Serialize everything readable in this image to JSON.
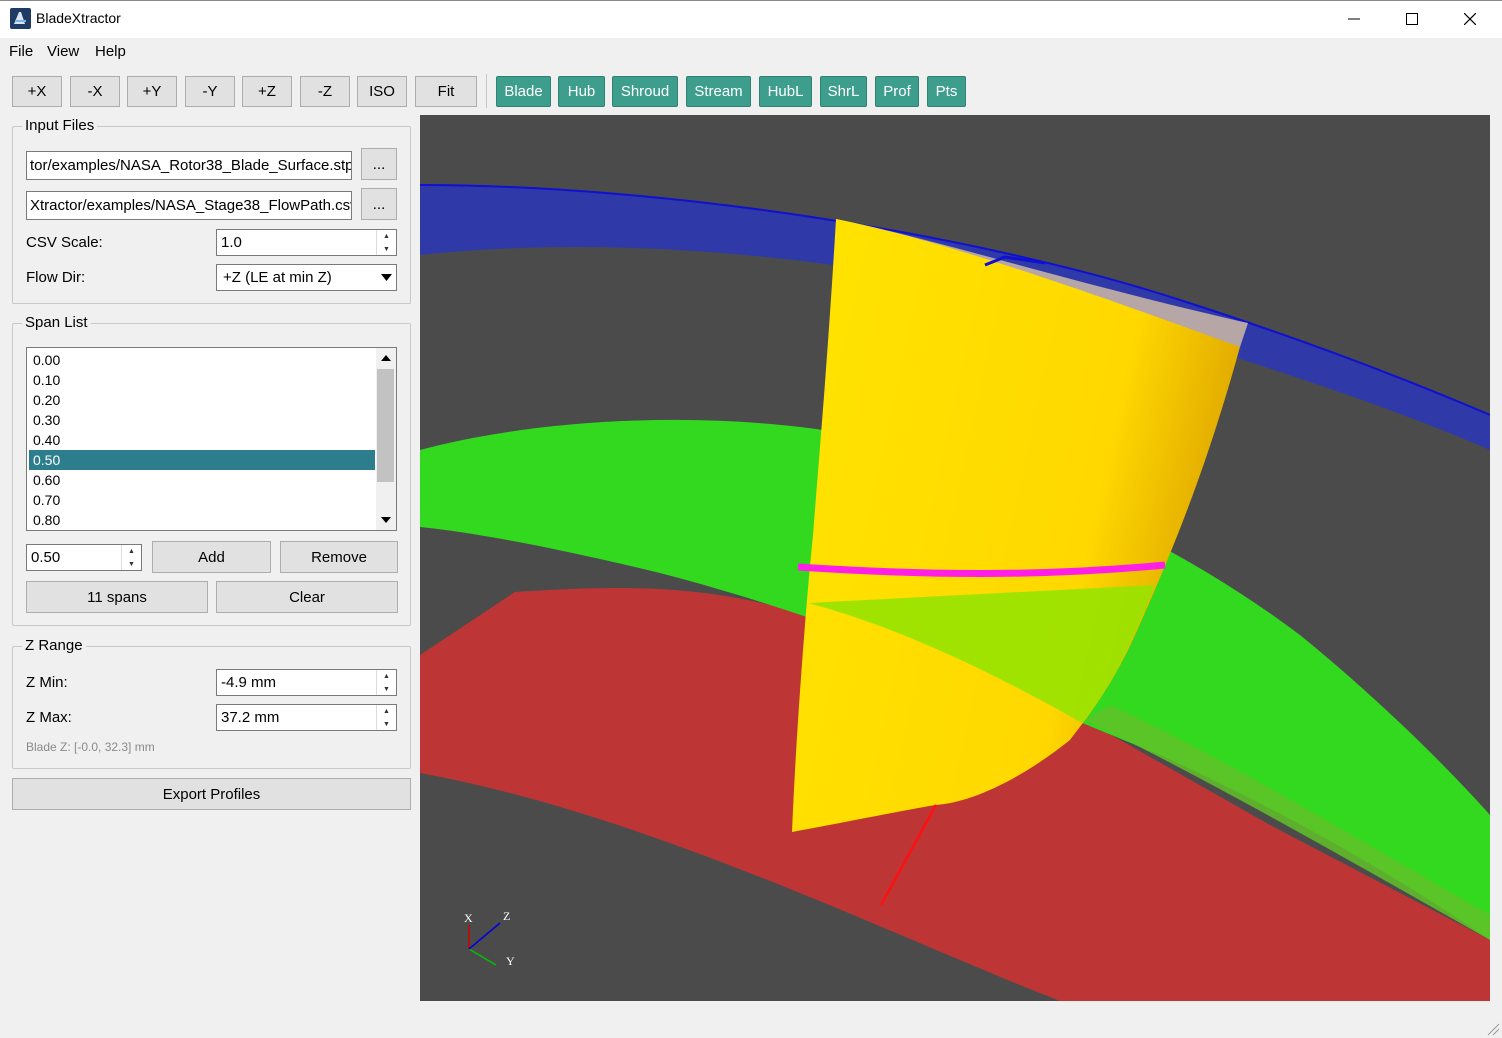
{
  "window": {
    "title": "BladeXtractor",
    "minimize_glyph": "—",
    "maximize_glyph": "☐",
    "close_glyph": "✕"
  },
  "menu": [
    "File",
    "View",
    "Help"
  ],
  "toolbar": {
    "view_buttons": [
      "+X",
      "-X",
      "+Y",
      "-Y",
      "+Z",
      "-Z",
      "ISO",
      "Fit"
    ],
    "toggle_buttons": [
      "Blade",
      "Hub",
      "Shroud",
      "Stream",
      "HubL",
      "ShrL",
      "Prof",
      "Pts"
    ],
    "toggle_color": "#3d9e8d"
  },
  "input_files": {
    "title": "Input Files",
    "step_path": "tor/examples/NASA_Rotor38_Blade_Surface.stp",
    "csv_path": "Xtractor/examples/NASA_Stage38_FlowPath.csv",
    "browse_label": "...",
    "csv_scale_label": "CSV Scale:",
    "csv_scale_value": "1.0",
    "flow_dir_label": "Flow Dir:",
    "flow_dir_value": "+Z (LE at min Z)"
  },
  "span_list": {
    "title": "Span List",
    "items": [
      "0.00",
      "0.10",
      "0.20",
      "0.30",
      "0.40",
      "0.50",
      "0.60",
      "0.70",
      "0.80"
    ],
    "selected_index": 5,
    "span_value": "0.50",
    "add_label": "Add",
    "remove_label": "Remove",
    "count_label": "11 spans",
    "clear_label": "Clear"
  },
  "z_range": {
    "title": "Z Range",
    "zmin_label": "Z Min:",
    "zmin_value": "-4.9 mm",
    "zmax_label": "Z Max:",
    "zmax_value": "37.2 mm",
    "blade_z_info": "Blade Z: [-0.0, 32.3] mm"
  },
  "export_label": "Export Profiles",
  "viewport": {
    "background": "#4b4b4b",
    "blade_color": "#ffdf00",
    "hub_color": "#be3535",
    "stream_color": "#33d91f",
    "shroud_color": "#2f3aa8",
    "profile_color": "#ff1fe6",
    "axes": {
      "x": "X",
      "y": "Y",
      "z": "Z"
    }
  }
}
